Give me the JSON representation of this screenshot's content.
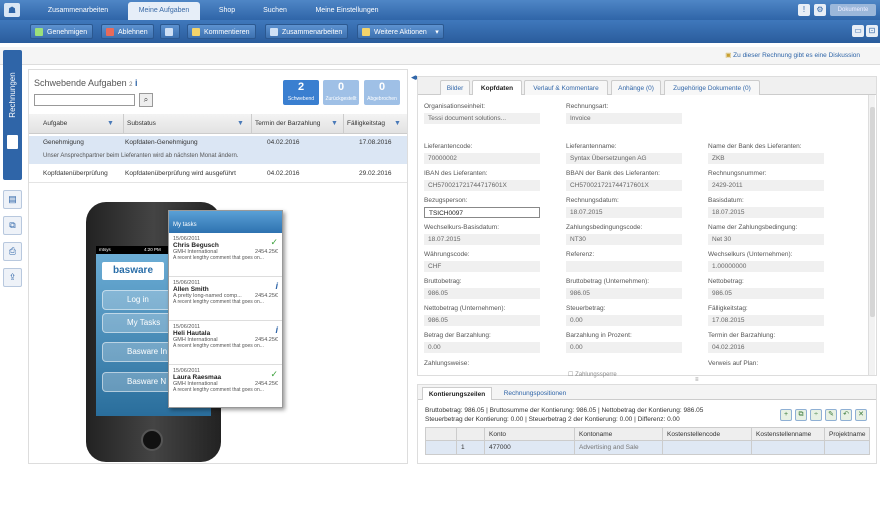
{
  "nav": {
    "tabs": [
      "Zusammenarbeiten",
      "Meine Aufgaben",
      "Shop",
      "Suchen",
      "Meine Einstellungen"
    ],
    "active": 1,
    "search_placeholder": "Dokumente"
  },
  "toolbar": {
    "buttons": [
      "Genehmigen",
      "Ablehnen",
      "",
      "Kommentieren",
      "Zusammenarbeiten",
      "Weitere Aktionen"
    ]
  },
  "discussion_link": "Zu dieser Rechnung gibt es eine Diskussion",
  "side_tab_label": "Rechnungen",
  "tasks": {
    "title": "Schwebende Aufgaben",
    "count": "2",
    "stats": [
      {
        "value": "2",
        "label": "Schwebend",
        "color": "#3a7fd0"
      },
      {
        "value": "0",
        "label": "Zurückgestellt",
        "color": "#9fc0e6"
      },
      {
        "value": "0",
        "label": "Abgebrochen",
        "color": "#9fc0e6"
      }
    ],
    "columns": [
      "Aufgabe",
      "Substatus",
      "Termin der Barzahlung",
      "Fälligkeitstag"
    ],
    "rows": [
      {
        "aufgabe": "Genehmigung",
        "substatus": "Kopfdaten-Genehmigung",
        "termin": "04.02.2016",
        "faellig": "17.08.2016",
        "note": "Unser Ansprechpartner beim Lieferanten wird ab nächsten Monat ändern."
      },
      {
        "aufgabe": "Kopfdatenüberprüfung",
        "substatus": "Kopfdatenüberprüfung wird ausgeführt",
        "termin": "04.02.2016",
        "faellig": "29.02.2016",
        "note": ""
      }
    ]
  },
  "phone": {
    "status_carrier": "mtsys",
    "status_time": "4:20 PM",
    "logo": "basware",
    "buttons": [
      "Log in",
      "My Tasks",
      "Basware In",
      "Basware N"
    ],
    "mytasks_title": "My tasks",
    "items": [
      {
        "date": "15/06/2011",
        "name": "Chris Begusch",
        "company": "GMH International",
        "amount": "2454.25€",
        "comment": "A recent lengthy comment that goes on...",
        "mark": "✓"
      },
      {
        "date": "15/06/2011",
        "name": "Allen Smith",
        "company": "A pretty long-named comp...",
        "amount": "2454.25€",
        "comment": "A recent lengthy comment that goes on...",
        "mark": "i"
      },
      {
        "date": "15/06/2011",
        "name": "Heli Hautala",
        "company": "GMH International",
        "amount": "2454.25€",
        "comment": "A recent lengthy comment that goes on...",
        "mark": "i"
      },
      {
        "date": "15/06/2011",
        "name": "Laura Raesmaa",
        "company": "GMH International",
        "amount": "2454.25€",
        "comment": "A recent lengthy comment that goes on...",
        "mark": "✓"
      }
    ]
  },
  "detail": {
    "tabs": [
      "Bilder",
      "Kopfdaten",
      "Verlauf & Kommentare",
      "Anhänge (0)",
      "Zugehörige Dokumente (0)"
    ],
    "active_tab": 1,
    "fields": [
      {
        "label": "Organisationseinheit:",
        "value": "Tessi document solutions...",
        "col": 0,
        "row": 0
      },
      {
        "label": "Rechnungsart:",
        "value": "Invoice",
        "col": 1,
        "row": 0
      },
      {
        "label": "Lieferantencode:",
        "value": "70000002",
        "col": 0,
        "row": 1
      },
      {
        "label": "Lieferantenname:",
        "value": "Syntax Übersetzungen AG",
        "col": 1,
        "row": 1
      },
      {
        "label": "Name der Bank des Lieferanten:",
        "value": "ZKB",
        "col": 2,
        "row": 1
      },
      {
        "label": "IBAN des Lieferanten:",
        "value": "CH5700217217447176​01X",
        "col": 0,
        "row": 2
      },
      {
        "label": "BBAN der Bank des Lieferanten:",
        "value": "CH5700217217447176​01X",
        "col": 1,
        "row": 2
      },
      {
        "label": "Rechnungsnummer:",
        "value": "2429-2011",
        "col": 2,
        "row": 2
      },
      {
        "label": "Bezugsperson:",
        "value": "TSICH0097",
        "col": 0,
        "row": 3,
        "edit": true
      },
      {
        "label": "Rechnungsdatum:",
        "value": "18.07.2015",
        "col": 1,
        "row": 3
      },
      {
        "label": "Basisdatum:",
        "value": "18.07.2015",
        "col": 2,
        "row": 3
      },
      {
        "label": "Wechselkurs-Basisdatum:",
        "value": "18.07.2015",
        "col": 0,
        "row": 4
      },
      {
        "label": "Zahlungsbedingungscode:",
        "value": "NT30",
        "col": 1,
        "row": 4
      },
      {
        "label": "Name der Zahlungsbedingung:",
        "value": "Net 30",
        "col": 2,
        "row": 4
      },
      {
        "label": "Währungscode:",
        "value": "CHF",
        "col": 0,
        "row": 5
      },
      {
        "label": "Referenz:",
        "value": "",
        "col": 1,
        "row": 5
      },
      {
        "label": "Wechselkurs (Unternehmen):",
        "value": "1.00000000",
        "col": 2,
        "row": 5
      },
      {
        "label": "Bruttobetrag:",
        "value": "986.05",
        "col": 0,
        "row": 6
      },
      {
        "label": "Bruttobetrag (Unternehmen):",
        "value": "986.05",
        "col": 1,
        "row": 6
      },
      {
        "label": "Nettobetrag:",
        "value": "986.05",
        "col": 2,
        "row": 6
      },
      {
        "label": "Nettobetrag (Unternehmen):",
        "value": "986.05",
        "col": 0,
        "row": 7
      },
      {
        "label": "Steuerbetrag:",
        "value": "0.00",
        "col": 1,
        "row": 7
      },
      {
        "label": "Fälligkeitstag:",
        "value": "17.08.2015",
        "col": 2,
        "row": 7
      },
      {
        "label": "Betrag der Barzahlung:",
        "value": "0.00",
        "col": 0,
        "row": 8
      },
      {
        "label": "Barzahlung in Prozent:",
        "value": "0.00",
        "col": 1,
        "row": 8
      },
      {
        "label": "Termin der Barzahlung:",
        "value": "04.02.2016",
        "col": 2,
        "row": 8
      },
      {
        "label": "Zahlungsweise:",
        "value": "",
        "col": 0,
        "row": 9
      },
      {
        "label": "Verweis auf Plan:",
        "value": "",
        "col": 2,
        "row": 9
      }
    ],
    "checkbox_label": "Zahlungssperre"
  },
  "coding": {
    "tabs": [
      "Kontierungszeilen",
      "Rechnungspositionen"
    ],
    "summary_line1": "Bruttobetrag:   986.05    |   Bruttosumme der Kontierung:   986.05   |   Nettobetrag der Kontierung:   986.05",
    "summary_line2": "Steuerbetrag der Kontierung:   0.00      |   Steuerbetrag 2 der Kontierung:   0.00      |   Differenz:   0.00",
    "columns": [
      "",
      "",
      "Konto",
      "Kontoname",
      "Kostenstellencode",
      "Kostenstellenname",
      "Projektname"
    ],
    "row": [
      "",
      "1",
      "477000",
      "Advertising and Sale",
      "",
      "",
      ""
    ]
  }
}
